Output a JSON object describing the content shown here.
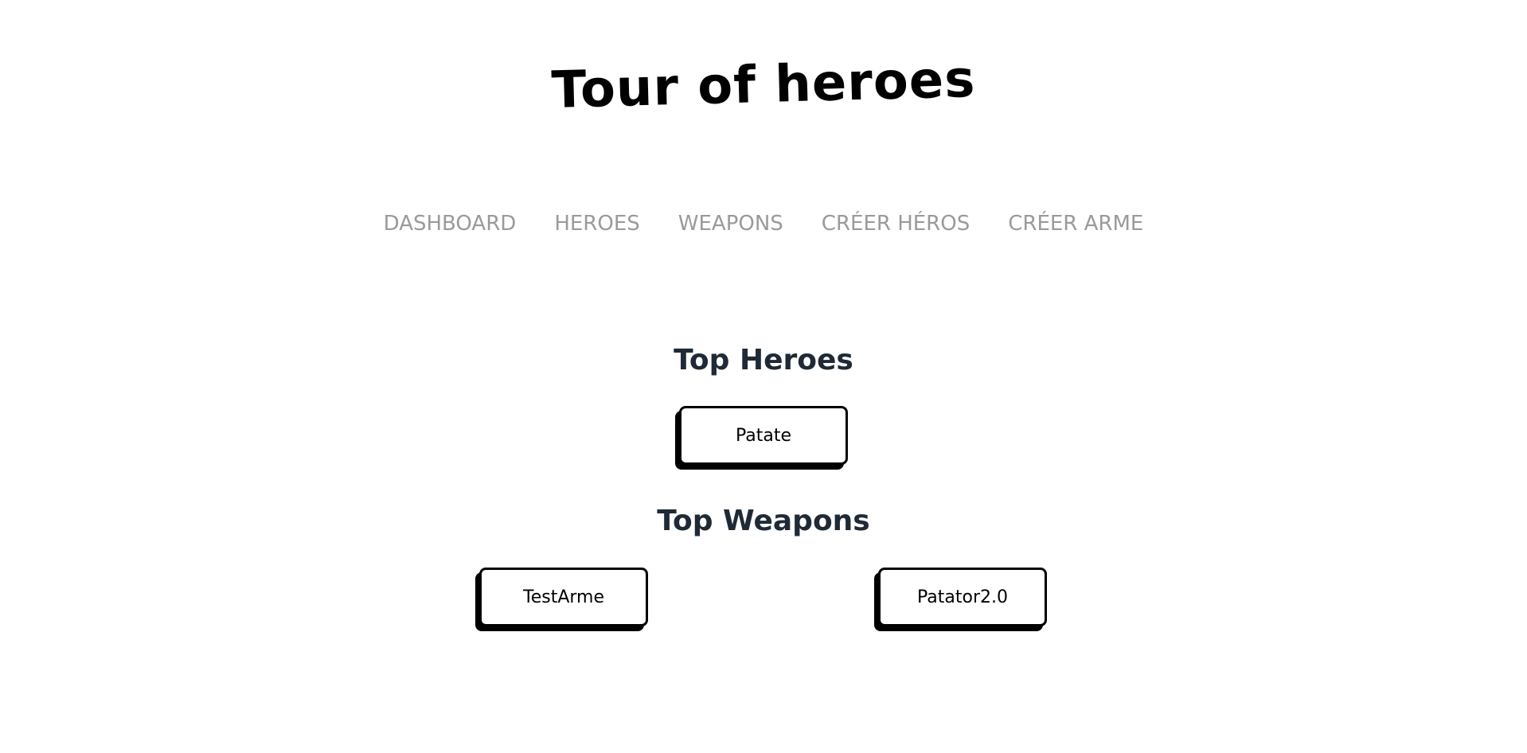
{
  "header": {
    "title": "Tour of heroes"
  },
  "nav": {
    "items": [
      {
        "label": "DASHBOARD"
      },
      {
        "label": "HEROES"
      },
      {
        "label": "WEAPONS"
      },
      {
        "label": "CRÉER HÉROS"
      },
      {
        "label": "CRÉER ARME"
      }
    ]
  },
  "dashboard": {
    "top_heroes_title": "Top Heroes",
    "heroes": [
      {
        "name": "Patate"
      }
    ],
    "top_weapons_title": "Top Weapons",
    "weapons": [
      {
        "name": "TestArme"
      },
      {
        "name": "Patator2.0"
      }
    ]
  },
  "colors": {
    "nav_text": "#9a9a9a",
    "section_title": "#1f2a36",
    "card_border": "#000000",
    "background": "#ffffff"
  }
}
